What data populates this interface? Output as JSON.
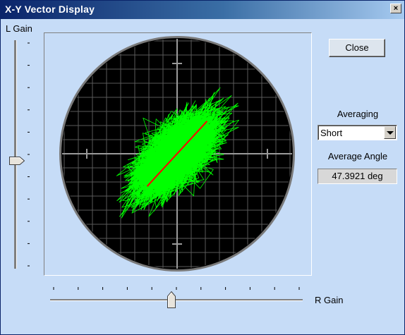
{
  "window": {
    "title": "X-Y Vector Display",
    "close_glyph": "×"
  },
  "left_gain": {
    "label": "L Gain",
    "level": 0.53,
    "ticks": 11
  },
  "right_gain": {
    "label": "R Gain",
    "level": 0.48,
    "ticks": 11
  },
  "buttons": {
    "close_label": "Close"
  },
  "averaging": {
    "label": "Averaging",
    "selected": "Short"
  },
  "angle": {
    "label": "Average Angle",
    "value": "47.3921 deg",
    "degrees": 47.3921
  },
  "scope": {
    "background": "#000000",
    "trace_color": "#00ff00",
    "vector_color": "#ff0000",
    "grid_color": "#5a5a5a",
    "bezel_color": "#7a7a7a",
    "vector_length": 0.38,
    "icons": {
      "trace": "lissajous-trace",
      "vector": "average-vector"
    }
  }
}
